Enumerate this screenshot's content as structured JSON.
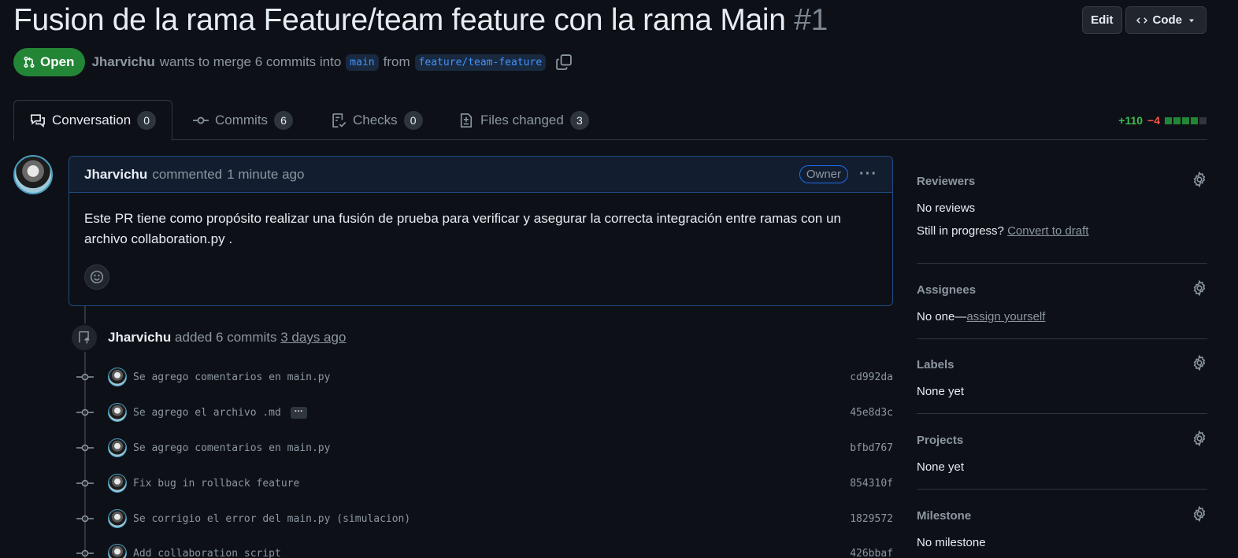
{
  "header": {
    "title": "Fusion de la rama Feature/team feature con la rama Main",
    "number": "#1",
    "edit_label": "Edit",
    "code_label": "Code"
  },
  "state": {
    "label": "Open",
    "author": "Jharvichu",
    "text_before": "wants to merge 6 commits into",
    "base_branch": "main",
    "text_from": "from",
    "head_branch": "feature/team-feature"
  },
  "tabs": [
    {
      "label": "Conversation",
      "count": "0",
      "icon": "comment-discussion-icon"
    },
    {
      "label": "Commits",
      "count": "6",
      "icon": "commit-icon"
    },
    {
      "label": "Checks",
      "count": "0",
      "icon": "checklist-icon"
    },
    {
      "label": "Files changed",
      "count": "3",
      "icon": "file-diff-icon"
    }
  ],
  "diffstat": {
    "additions": "+110",
    "deletions": "−4",
    "blocks": [
      "#238636",
      "#238636",
      "#238636",
      "#238636",
      "#30363d"
    ]
  },
  "comment": {
    "author": "Jharvichu",
    "action": "commented",
    "time": "1 minute ago",
    "role": "Owner",
    "body": "Este PR tiene como propósito realizar una fusión de prueba para verificar y asegurar la correcta integración entre ramas con un archivo collaboration.py ."
  },
  "timeline": {
    "author": "Jharvichu",
    "action": "added 6 commits",
    "time": "3 days ago",
    "commits": [
      {
        "message": "Se agrego comentarios en main.py",
        "sha": "cd992da",
        "has_more": false
      },
      {
        "message": "Se agrego el archivo .md",
        "sha": "45e8d3c",
        "has_more": true
      },
      {
        "message": "Se agrego comentarios en main.py",
        "sha": "bfbd767",
        "has_more": false
      },
      {
        "message": "Fix bug in rollback feature",
        "sha": "854310f",
        "has_more": false
      },
      {
        "message": "Se corrigio el error del main.py (simulacion)",
        "sha": "1829572",
        "has_more": false
      },
      {
        "message": "Add collaboration script",
        "sha": "426bbaf",
        "has_more": false
      }
    ],
    "more_label": "···"
  },
  "sidebar": {
    "reviewers": {
      "title": "Reviewers",
      "value": "No reviews",
      "draft_prefix": "Still in progress?",
      "draft_link": "Convert to draft"
    },
    "assignees": {
      "title": "Assignees",
      "prefix": "No one—",
      "link": "assign yourself"
    },
    "labels": {
      "title": "Labels",
      "value": "None yet"
    },
    "projects": {
      "title": "Projects",
      "value": "None yet"
    },
    "milestone": {
      "title": "Milestone",
      "value": "No milestone"
    }
  },
  "colors": {
    "background": "#0d1117",
    "open_green": "#238636",
    "link_blue": "#4493f8",
    "add_green": "#3fb950",
    "del_red": "#f85149"
  }
}
